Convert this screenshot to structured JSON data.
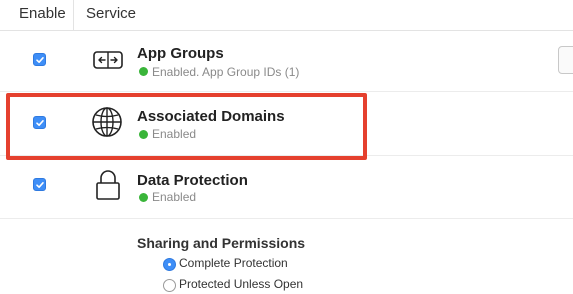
{
  "header": {
    "enable_label": "Enable",
    "service_label": "Service"
  },
  "services": [
    {
      "title": "App Groups",
      "status": "Enabled. App Group IDs (1)",
      "enabled": true,
      "icon": "app-groups-icon"
    },
    {
      "title": "Associated Domains",
      "status": "Enabled",
      "enabled": true,
      "icon": "globe-icon"
    },
    {
      "title": "Data Protection",
      "status": "Enabled",
      "enabled": true,
      "icon": "lock-icon"
    }
  ],
  "data_protection": {
    "section_title": "Sharing and Permissions",
    "options": [
      {
        "label": "Complete Protection",
        "selected": true
      },
      {
        "label": "Protected Unless Open",
        "selected": false
      }
    ]
  },
  "colors": {
    "checkbox_blue": "#3e8ef7",
    "status_green": "#3ab53a",
    "highlight_red": "#e5402e"
  }
}
